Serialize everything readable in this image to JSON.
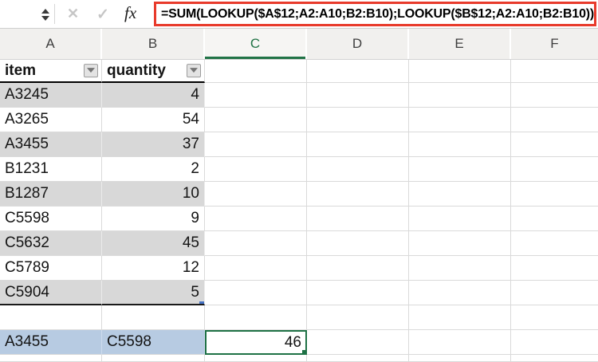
{
  "formula_bar": {
    "formula": "=SUM(LOOKUP($A$12;A2:A10;B2:B10);LOOKUP($B$12;A2:A10;B2:B10))",
    "fx_label": "fx",
    "cancel_label": "✕",
    "confirm_label": "✓"
  },
  "column_headers": [
    "A",
    "B",
    "C",
    "D",
    "E",
    "F"
  ],
  "selected_column": "C",
  "sheet": {
    "header_row": {
      "item_label": "item",
      "quantity_label": "quantity"
    },
    "data_rows": [
      {
        "item": "A3245",
        "quantity": "4"
      },
      {
        "item": "A3265",
        "quantity": "54"
      },
      {
        "item": "A3455",
        "quantity": "37"
      },
      {
        "item": "B1231",
        "quantity": "2"
      },
      {
        "item": "B1287",
        "quantity": "10"
      },
      {
        "item": "C5598",
        "quantity": "9"
      },
      {
        "item": "C5632",
        "quantity": "45"
      },
      {
        "item": "C5789",
        "quantity": "12"
      },
      {
        "item": "C5904",
        "quantity": "5"
      }
    ],
    "lookup_row": {
      "item_key": "A3455",
      "quantity_key": "C5598",
      "result": "46"
    }
  },
  "colors": {
    "formula_border_red": "#e83a2b",
    "selection_green": "#1e7145",
    "header_green": "#217346",
    "band_gray": "#d8d8d8",
    "lookup_blue": "#b7cbe2",
    "table_handle_blue": "#4472c4"
  }
}
